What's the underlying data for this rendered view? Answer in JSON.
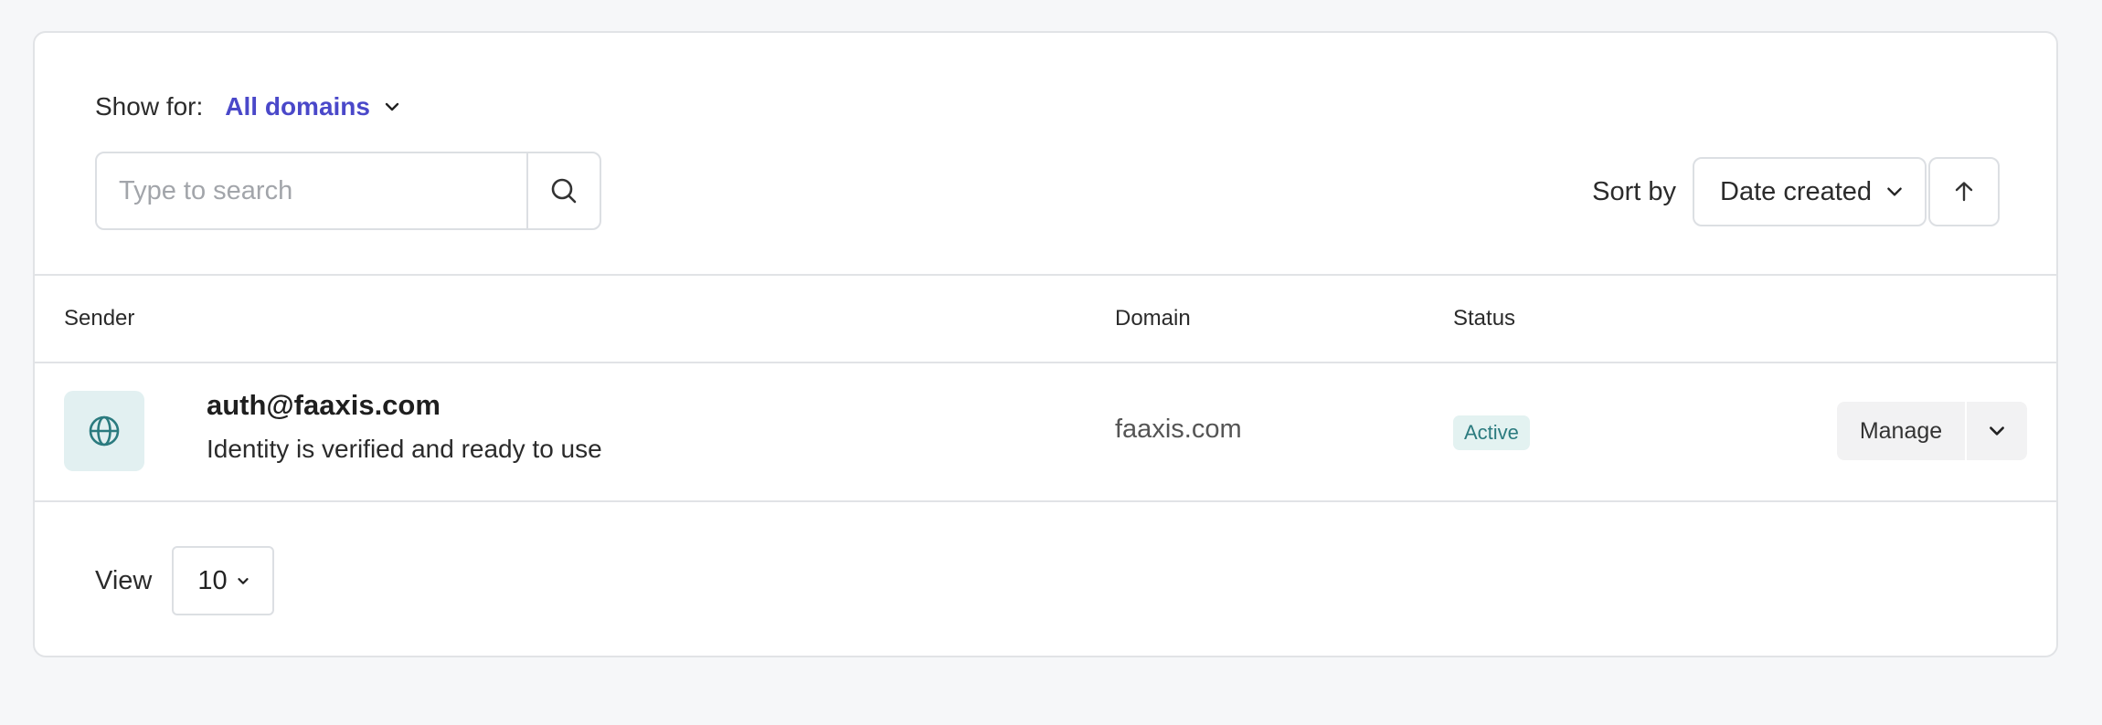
{
  "filter": {
    "show_for_label": "Show for:",
    "show_for_value": "All domains"
  },
  "search": {
    "placeholder": "Type to search",
    "value": ""
  },
  "sort": {
    "label": "Sort by",
    "value": "Date created",
    "direction": "ascending"
  },
  "table": {
    "columns": [
      "Sender",
      "Domain",
      "Status"
    ],
    "rows": [
      {
        "sender": "auth@faaxis.com",
        "description": "Identity is verified and ready to use",
        "domain": "faaxis.com",
        "status": "Active",
        "action_label": "Manage"
      }
    ]
  },
  "pagination": {
    "view_label": "View",
    "per_page": "10"
  },
  "colors": {
    "accent": "#4a48c9",
    "status_active_bg": "#e3f2f1",
    "status_active_text": "#2b7b7f",
    "avatar_bg": "#e2f0f1"
  },
  "icons": {
    "filter_chevron": "chevron-down-icon",
    "search": "search-icon",
    "sort_chevron": "chevron-down-icon",
    "sort_direction": "arrow-up-icon",
    "avatar": "globe-icon",
    "row_more": "chevron-down-icon",
    "per_page_chevron": "chevron-down-icon"
  }
}
